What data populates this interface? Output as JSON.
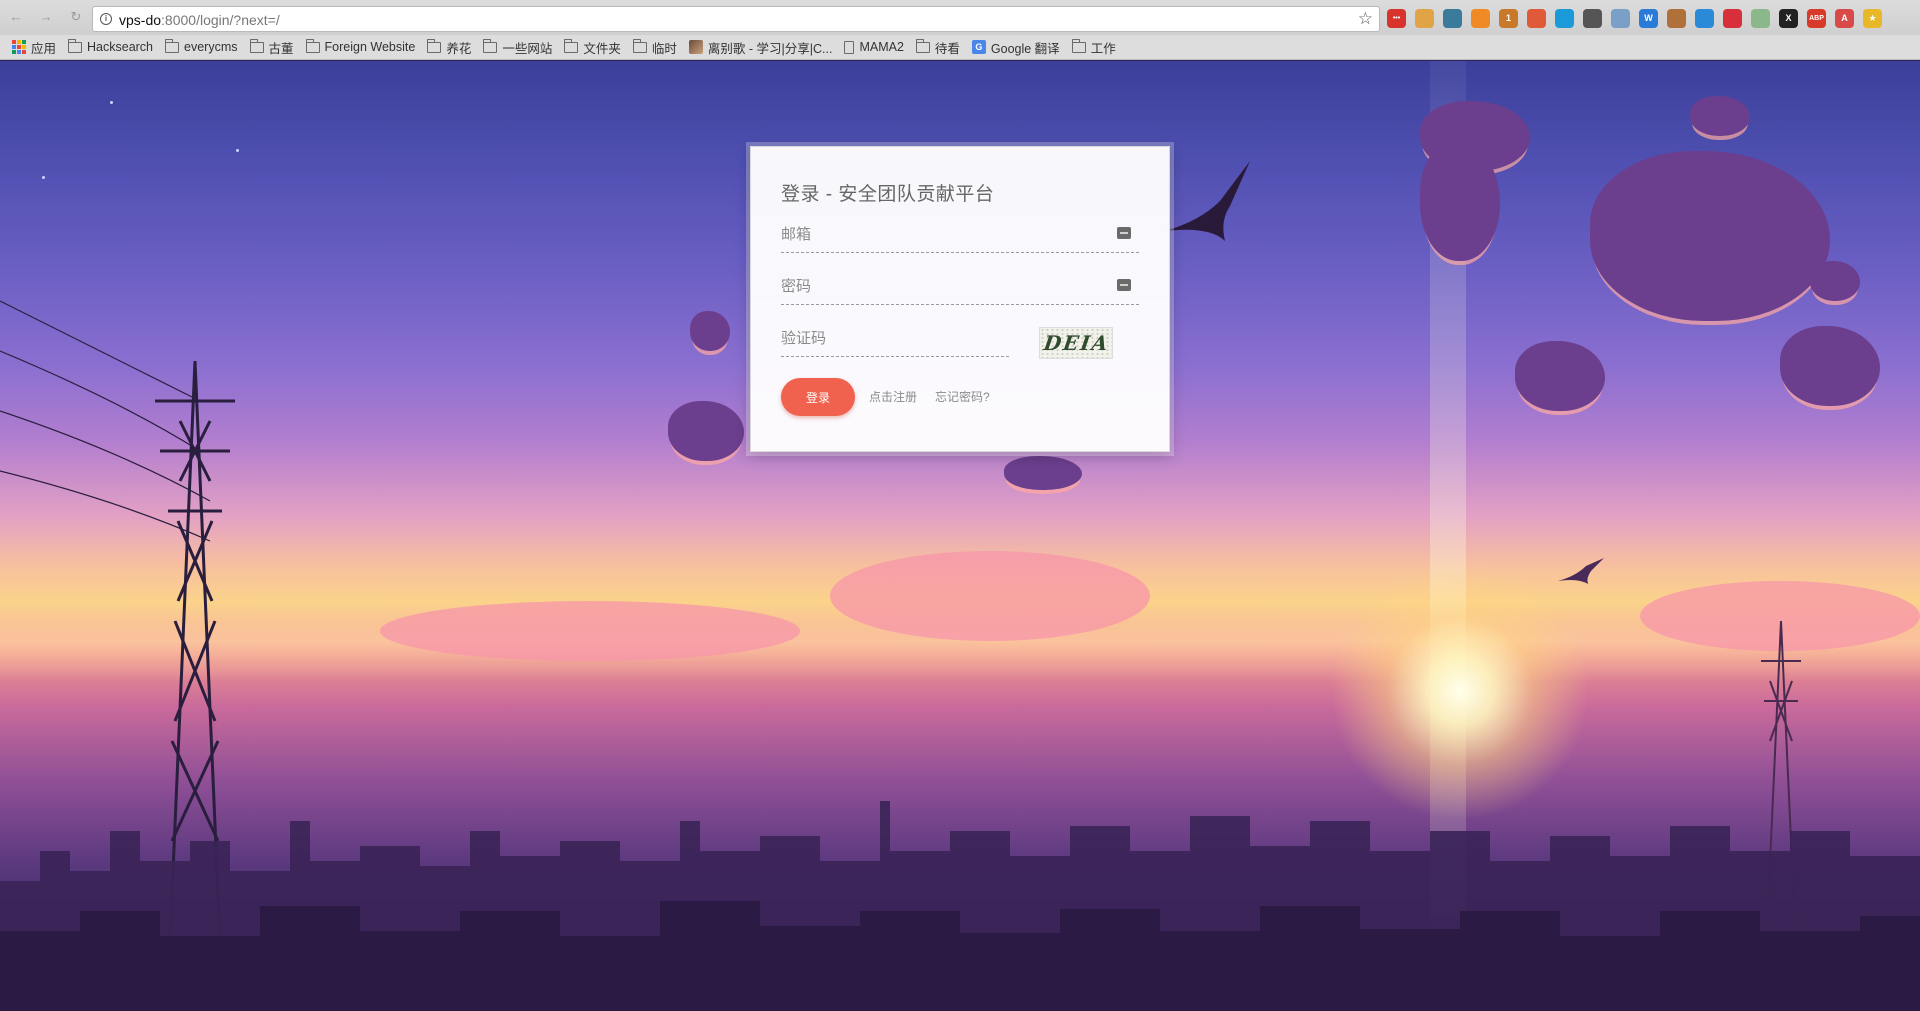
{
  "browser": {
    "url_host": "vps-do",
    "url_rest": ":8000/login/?next=/",
    "back_icon": "back-arrow-icon",
    "forward_icon": "forward-arrow-icon",
    "reload_icon": "reload-icon"
  },
  "extensions": [
    {
      "name": "ext-red-dots-icon",
      "color": "#d8342c",
      "label": "•••"
    },
    {
      "name": "ext-cookie-icon",
      "color": "#e0a446",
      "label": ""
    },
    {
      "name": "ext-dragon-icon",
      "color": "#3a7a9a",
      "label": ""
    },
    {
      "name": "ext-rss-icon",
      "color": "#f08a24",
      "label": ""
    },
    {
      "name": "ext-badge-icon",
      "color": "#c87a2a",
      "label": "1"
    },
    {
      "name": "ext-weibo-icon",
      "color": "#e05a3a",
      "label": ""
    },
    {
      "name": "ext-square-icon",
      "color": "#1a9ad8",
      "label": ""
    },
    {
      "name": "ext-shield-icon",
      "color": "#555555",
      "label": ""
    },
    {
      "name": "ext-note-icon",
      "color": "#7aa0c8",
      "label": ""
    },
    {
      "name": "ext-w-icon",
      "color": "#2a7ad8",
      "label": "W"
    },
    {
      "name": "ext-monkey-icon",
      "color": "#b0703a",
      "label": ""
    },
    {
      "name": "ext-diamond-icon",
      "color": "#2a8ad8",
      "label": ""
    },
    {
      "name": "ext-ruby-icon",
      "color": "#d8303a",
      "label": ""
    },
    {
      "name": "ext-circle-icon",
      "color": "#8ab88a",
      "label": ""
    },
    {
      "name": "ext-x-icon",
      "color": "#222222",
      "label": "X"
    },
    {
      "name": "ext-abp-icon",
      "color": "#d83a2a",
      "label": "ABP"
    },
    {
      "name": "ext-a-icon",
      "color": "#d84a4a",
      "label": "A"
    },
    {
      "name": "ext-star-icon",
      "color": "#e8b828",
      "label": "★"
    }
  ],
  "bookmarks": [
    {
      "label": "应用",
      "icon": "apps-grid-icon"
    },
    {
      "label": "Hacksearch",
      "icon": "folder-icon"
    },
    {
      "label": "everycms",
      "icon": "folder-icon"
    },
    {
      "label": "古董",
      "icon": "folder-icon"
    },
    {
      "label": "Foreign Website",
      "icon": "folder-icon"
    },
    {
      "label": "养花",
      "icon": "folder-icon"
    },
    {
      "label": "一些网站",
      "icon": "folder-icon"
    },
    {
      "label": "文件夹",
      "icon": "folder-icon"
    },
    {
      "label": "临时",
      "icon": "folder-icon"
    },
    {
      "label": "离别歌 - 学习|分享|C...",
      "icon": "favicon-image-icon"
    },
    {
      "label": "MAMA2",
      "icon": "page-icon"
    },
    {
      "label": "待看",
      "icon": "folder-icon"
    },
    {
      "label": "Google 翻译",
      "icon": "google-translate-icon"
    },
    {
      "label": "工作",
      "icon": "folder-icon"
    }
  ],
  "login": {
    "title": "登录 - 安全团队贡献平台",
    "email_placeholder": "邮箱",
    "password_placeholder": "密码",
    "captcha_placeholder": "验证码",
    "captcha_text": "DEIA",
    "submit_label": "登录",
    "register_link": "点击注册",
    "forgot_link": "忘记密码?"
  },
  "colors": {
    "accent": "#f0614e"
  }
}
